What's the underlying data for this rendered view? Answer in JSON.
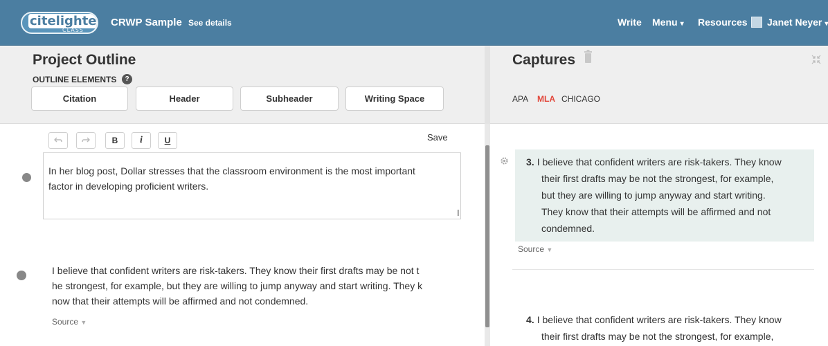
{
  "topbar": {
    "logo_text": "citelighter",
    "logo_sub": "CLASS",
    "project_title": "CRWP Sample",
    "see_details": "See details",
    "nav_write": "Write",
    "nav_menu": "Menu",
    "nav_resources": "Resources",
    "user_name": "Janet Neyer"
  },
  "outline": {
    "title": "Project Outline",
    "elements_label": "OUTLINE ELEMENTS",
    "help": "?",
    "buttons": [
      "Citation",
      "Header",
      "Subheader",
      "Writing Space"
    ],
    "toolbar": {
      "bold": "B",
      "italic": "i",
      "underline": "U",
      "save": "Save"
    },
    "editor_line1": "In her blog post, Dollar stresses that the classroom environment is the most important",
    "editor_line2": "factor in developing proficient writers.",
    "quote_line1": "I believe that confident writers are risk-takers. They know their first drafts may be not t",
    "quote_line2": "he strongest, for example, but they are willing to jump anyway and start writing. They k",
    "quote_line3": "now that their attempts will be affirmed and not condemned.",
    "source": "Source"
  },
  "captures": {
    "title": "Captures",
    "styles": [
      {
        "label": "APA",
        "active": false
      },
      {
        "label": "MLA",
        "active": true
      },
      {
        "label": "CHICAGO",
        "active": false
      }
    ],
    "items": [
      {
        "number": "3.",
        "lines": [
          "I believe that confident writers are risk-takers. They know",
          "their first drafts may be not the strongest, for example,",
          "but they are willing to jump anyway and start writing.",
          "They know that their attempts will be affirmed and not",
          "condemned."
        ],
        "source": "Source"
      },
      {
        "number": "4.",
        "lines": [
          "I believe that confident writers are risk-takers. They know",
          "their first drafts may be not the strongest, for example,"
        ]
      }
    ]
  },
  "colors": {
    "topbar": "#4b7ea1",
    "accent_active": "#e2463a",
    "capture_highlight": "#e8f0ee"
  }
}
